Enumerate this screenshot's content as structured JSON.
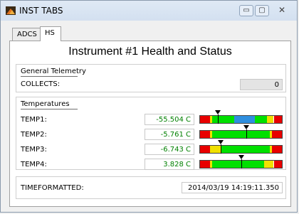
{
  "window": {
    "title": "INST TABS",
    "controls": {
      "minimize": "▭",
      "maximize": "▢",
      "close": "✕"
    }
  },
  "tabs": [
    {
      "label": "ADCS"
    },
    {
      "label": "HS"
    }
  ],
  "main": {
    "title": "Instrument #1 Health and Status"
  },
  "general": {
    "title": "General Telemetry",
    "collects_label": "COLLECTS:",
    "collects_value": "0"
  },
  "temperatures": {
    "title": "Temperatures",
    "items": [
      {
        "label": "TEMP1:",
        "value": "-55.504 C",
        "marker": 0.22
      },
      {
        "label": "TEMP2:",
        "value": "-5.761 C",
        "marker": 0.56
      },
      {
        "label": "TEMP3:",
        "value": "-6.743 C",
        "marker": 0.26
      },
      {
        "label": "TEMP4:",
        "value": "3.828 C",
        "marker": 0.5
      }
    ]
  },
  "time": {
    "label": "TIMEFORMATTED:",
    "value": "2014/03/19 14:19:11.350"
  },
  "colors": {
    "red": "#e80000",
    "yellow": "#f0e000",
    "green": "#00e000",
    "blue": "#2f8fdf",
    "value_green": "#008000"
  }
}
